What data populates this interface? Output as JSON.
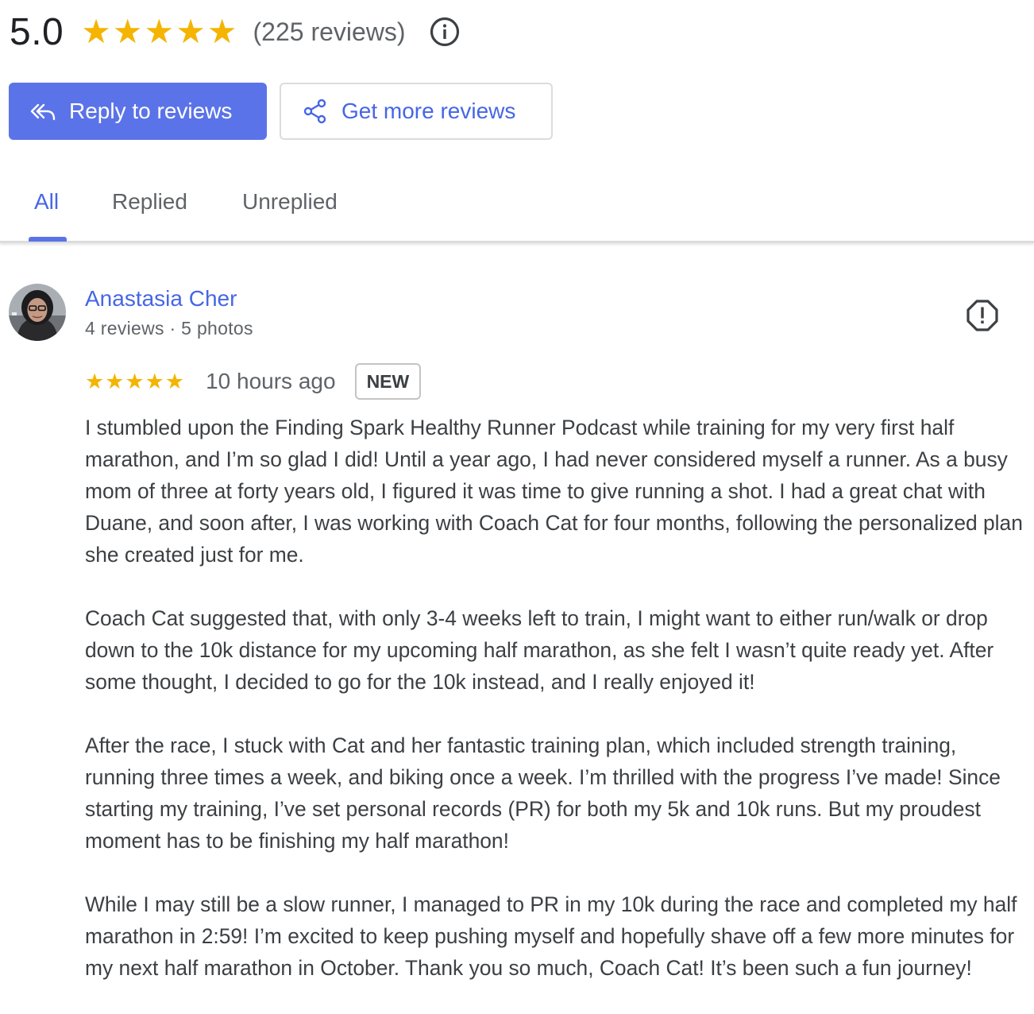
{
  "summary": {
    "score": "5.0",
    "stars": 5,
    "review_count_text": "(225 reviews)"
  },
  "actions": {
    "reply_label": "Reply to reviews",
    "get_more_label": "Get more reviews"
  },
  "tabs": [
    {
      "label": "All",
      "active": true
    },
    {
      "label": "Replied",
      "active": false
    },
    {
      "label": "Unreplied",
      "active": false
    }
  ],
  "review": {
    "reviewer_name": "Anastasia Cher",
    "reviewer_meta": "4 reviews · 5 photos",
    "rating": 5,
    "time": "10 hours ago",
    "badge": "NEW",
    "paragraphs": [
      "I stumbled upon the Finding Spark Healthy Runner Podcast while training for my very first half marathon, and I’m so glad I did! Until a year ago, I had never considered myself a runner. As a busy mom of three at forty years old, I figured it was time to give running a shot. I had a great chat with Duane, and soon after, I was working with Coach Cat for four months, following the personalized plan she created just for me.",
      "Coach Cat suggested that, with only 3-4 weeks left to train, I might want to either run/walk or drop down to the 10k distance for my upcoming half marathon, as she felt I wasn’t quite ready yet. After some thought, I decided to go for the 10k instead, and I really enjoyed it!",
      "After the race, I stuck with Cat and her fantastic training plan, which included strength training, running three times a week, and biking once a week. I’m thrilled with the progress I’ve made! Since starting my training, I’ve set personal records (PR) for both my 5k and 10k runs. But my proudest moment has to be finishing my half marathon!",
      "While I may still be a slow runner, I managed to PR in my 10k during the race and completed my half marathon in 2:59! I’m excited to keep pushing myself and hopefully shave off a few more minutes for my next half marathon in October. Thank you so much, Coach Cat! It’s been such a fun journey!"
    ]
  },
  "colors": {
    "accent": "#5b73e8",
    "link": "#4666e6",
    "star": "#f4b400"
  },
  "icons": {
    "info": "info-circle-icon",
    "reply": "reply-all-icon",
    "share": "share-icon",
    "flag": "report-flag-icon"
  }
}
